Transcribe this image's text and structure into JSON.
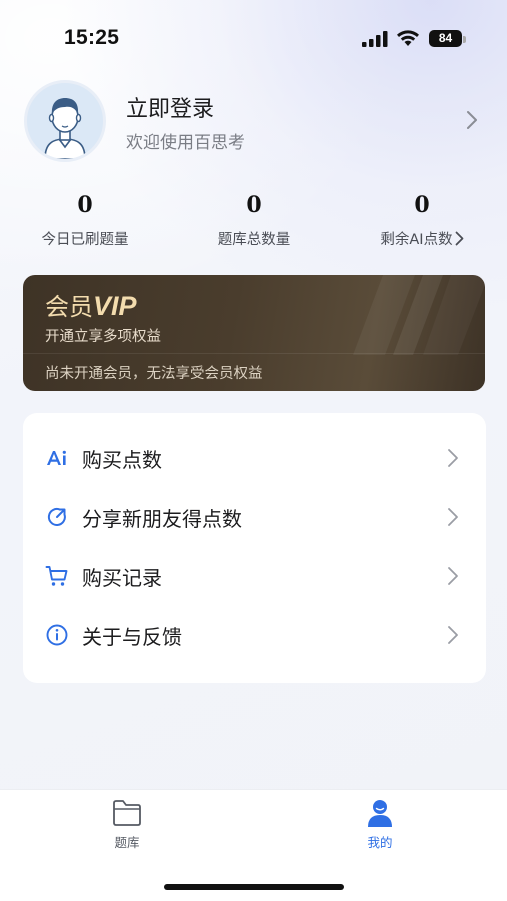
{
  "status_bar": {
    "time": "15:25",
    "battery": "84",
    "icons": [
      "signal-icon",
      "wifi-icon",
      "battery-icon"
    ]
  },
  "profile": {
    "title": "立即登录",
    "subtitle": "欢迎使用百思考",
    "avatar_icon": "user-avatar-icon",
    "chevron_icon": "chevron-right-icon"
  },
  "stats": [
    {
      "value": "0",
      "label": "今日已刷题量"
    },
    {
      "value": "0",
      "label": "题库总数量"
    },
    {
      "value": "0",
      "label": "剩余AI点数"
    }
  ],
  "vip": {
    "title_prefix": "会员",
    "title_badge": "VIP",
    "subtitle": "开通立享多项权益",
    "notice": "尚未开通会员，无法享受会员权益",
    "colors": {
      "card": "#4a3d2d",
      "title": "#f3dcae"
    }
  },
  "menu": [
    {
      "label": "购买点数",
      "icon": "ai-icon"
    },
    {
      "label": "分享新朋友得点数",
      "icon": "share-refresh-icon"
    },
    {
      "label": "购买记录",
      "icon": "cart-icon"
    },
    {
      "label": "关于与反馈",
      "icon": "info-icon"
    }
  ],
  "tab_bar": {
    "tabs": [
      {
        "label": "题库",
        "icon": "folder-icon",
        "active": false
      },
      {
        "label": "我的",
        "icon": "user-icon",
        "active": true
      }
    ],
    "colors": {
      "active": "#2f6fe4",
      "inactive": "#555a63"
    }
  },
  "colors": {
    "accent": "#2f6fe4"
  }
}
